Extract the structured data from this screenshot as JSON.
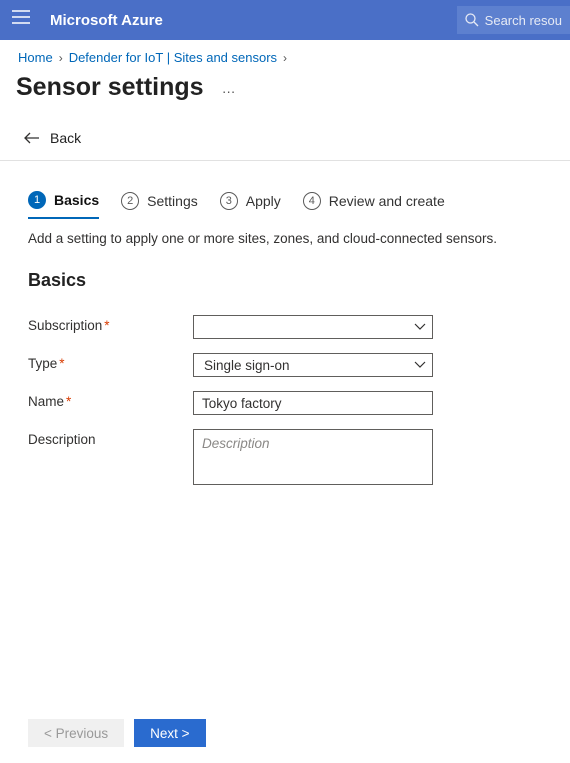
{
  "topbar": {
    "brand": "Microsoft Azure",
    "search_placeholder": "Search resou"
  },
  "breadcrumb": {
    "items": [
      "Home",
      "Defender for IoT | Sites and sensors"
    ]
  },
  "page": {
    "title": "Sensor settings",
    "back_label": "Back"
  },
  "tabs": {
    "items": [
      {
        "num": "1",
        "label": "Basics"
      },
      {
        "num": "2",
        "label": "Settings"
      },
      {
        "num": "3",
        "label": "Apply"
      },
      {
        "num": "4",
        "label": "Review and create"
      }
    ],
    "description": "Add a setting to apply one or more sites, zones, and cloud-connected sensors.",
    "section_heading": "Basics"
  },
  "form": {
    "subscription": {
      "label": "Subscription",
      "value": ""
    },
    "type": {
      "label": "Type",
      "value": "Single sign-on"
    },
    "name": {
      "label": "Name",
      "value": "Tokyo factory"
    },
    "description": {
      "label": "Description",
      "placeholder": "Description",
      "value": ""
    }
  },
  "footer": {
    "previous": "< Previous",
    "next": "Next >"
  }
}
